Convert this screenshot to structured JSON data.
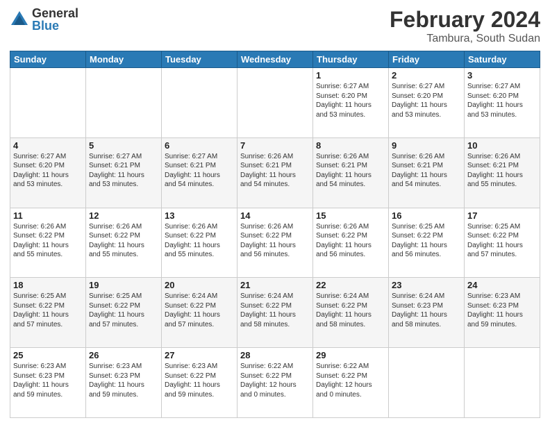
{
  "logo": {
    "general": "General",
    "blue": "Blue"
  },
  "title": {
    "month": "February 2024",
    "location": "Tambura, South Sudan"
  },
  "weekdays": [
    "Sunday",
    "Monday",
    "Tuesday",
    "Wednesday",
    "Thursday",
    "Friday",
    "Saturday"
  ],
  "weeks": [
    [
      {
        "day": "",
        "info": ""
      },
      {
        "day": "",
        "info": ""
      },
      {
        "day": "",
        "info": ""
      },
      {
        "day": "",
        "info": ""
      },
      {
        "day": "1",
        "info": "Sunrise: 6:27 AM\nSunset: 6:20 PM\nDaylight: 11 hours\nand 53 minutes."
      },
      {
        "day": "2",
        "info": "Sunrise: 6:27 AM\nSunset: 6:20 PM\nDaylight: 11 hours\nand 53 minutes."
      },
      {
        "day": "3",
        "info": "Sunrise: 6:27 AM\nSunset: 6:20 PM\nDaylight: 11 hours\nand 53 minutes."
      }
    ],
    [
      {
        "day": "4",
        "info": "Sunrise: 6:27 AM\nSunset: 6:20 PM\nDaylight: 11 hours\nand 53 minutes."
      },
      {
        "day": "5",
        "info": "Sunrise: 6:27 AM\nSunset: 6:21 PM\nDaylight: 11 hours\nand 53 minutes."
      },
      {
        "day": "6",
        "info": "Sunrise: 6:27 AM\nSunset: 6:21 PM\nDaylight: 11 hours\nand 54 minutes."
      },
      {
        "day": "7",
        "info": "Sunrise: 6:26 AM\nSunset: 6:21 PM\nDaylight: 11 hours\nand 54 minutes."
      },
      {
        "day": "8",
        "info": "Sunrise: 6:26 AM\nSunset: 6:21 PM\nDaylight: 11 hours\nand 54 minutes."
      },
      {
        "day": "9",
        "info": "Sunrise: 6:26 AM\nSunset: 6:21 PM\nDaylight: 11 hours\nand 54 minutes."
      },
      {
        "day": "10",
        "info": "Sunrise: 6:26 AM\nSunset: 6:21 PM\nDaylight: 11 hours\nand 55 minutes."
      }
    ],
    [
      {
        "day": "11",
        "info": "Sunrise: 6:26 AM\nSunset: 6:22 PM\nDaylight: 11 hours\nand 55 minutes."
      },
      {
        "day": "12",
        "info": "Sunrise: 6:26 AM\nSunset: 6:22 PM\nDaylight: 11 hours\nand 55 minutes."
      },
      {
        "day": "13",
        "info": "Sunrise: 6:26 AM\nSunset: 6:22 PM\nDaylight: 11 hours\nand 55 minutes."
      },
      {
        "day": "14",
        "info": "Sunrise: 6:26 AM\nSunset: 6:22 PM\nDaylight: 11 hours\nand 56 minutes."
      },
      {
        "day": "15",
        "info": "Sunrise: 6:26 AM\nSunset: 6:22 PM\nDaylight: 11 hours\nand 56 minutes."
      },
      {
        "day": "16",
        "info": "Sunrise: 6:25 AM\nSunset: 6:22 PM\nDaylight: 11 hours\nand 56 minutes."
      },
      {
        "day": "17",
        "info": "Sunrise: 6:25 AM\nSunset: 6:22 PM\nDaylight: 11 hours\nand 57 minutes."
      }
    ],
    [
      {
        "day": "18",
        "info": "Sunrise: 6:25 AM\nSunset: 6:22 PM\nDaylight: 11 hours\nand 57 minutes."
      },
      {
        "day": "19",
        "info": "Sunrise: 6:25 AM\nSunset: 6:22 PM\nDaylight: 11 hours\nand 57 minutes."
      },
      {
        "day": "20",
        "info": "Sunrise: 6:24 AM\nSunset: 6:22 PM\nDaylight: 11 hours\nand 57 minutes."
      },
      {
        "day": "21",
        "info": "Sunrise: 6:24 AM\nSunset: 6:22 PM\nDaylight: 11 hours\nand 58 minutes."
      },
      {
        "day": "22",
        "info": "Sunrise: 6:24 AM\nSunset: 6:22 PM\nDaylight: 11 hours\nand 58 minutes."
      },
      {
        "day": "23",
        "info": "Sunrise: 6:24 AM\nSunset: 6:23 PM\nDaylight: 11 hours\nand 58 minutes."
      },
      {
        "day": "24",
        "info": "Sunrise: 6:23 AM\nSunset: 6:23 PM\nDaylight: 11 hours\nand 59 minutes."
      }
    ],
    [
      {
        "day": "25",
        "info": "Sunrise: 6:23 AM\nSunset: 6:23 PM\nDaylight: 11 hours\nand 59 minutes."
      },
      {
        "day": "26",
        "info": "Sunrise: 6:23 AM\nSunset: 6:23 PM\nDaylight: 11 hours\nand 59 minutes."
      },
      {
        "day": "27",
        "info": "Sunrise: 6:23 AM\nSunset: 6:22 PM\nDaylight: 11 hours\nand 59 minutes."
      },
      {
        "day": "28",
        "info": "Sunrise: 6:22 AM\nSunset: 6:22 PM\nDaylight: 12 hours\nand 0 minutes."
      },
      {
        "day": "29",
        "info": "Sunrise: 6:22 AM\nSunset: 6:22 PM\nDaylight: 12 hours\nand 0 minutes."
      },
      {
        "day": "",
        "info": ""
      },
      {
        "day": "",
        "info": ""
      }
    ]
  ]
}
